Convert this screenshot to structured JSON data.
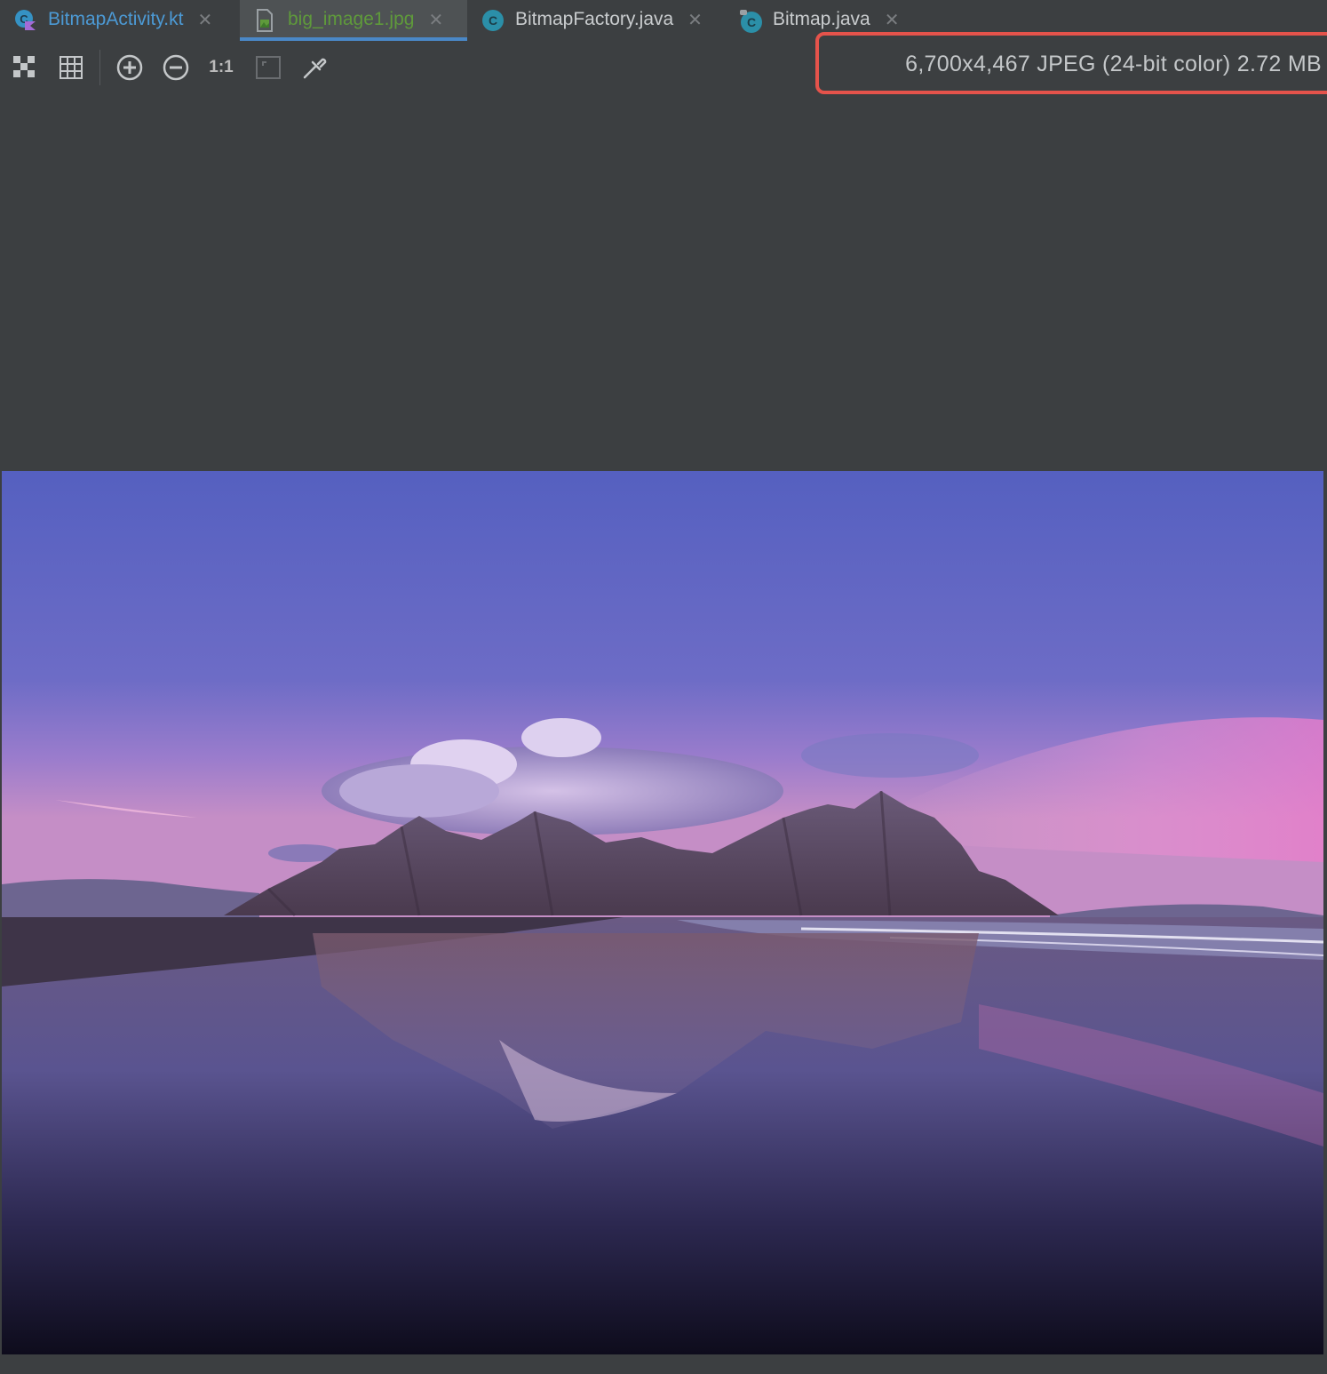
{
  "tabs": [
    {
      "label": "BitmapActivity.kt",
      "icon": "kotlin-class-icon",
      "active": false
    },
    {
      "label": "big_image1.jpg",
      "icon": "image-file-icon",
      "active": true
    },
    {
      "label": "BitmapFactory.java",
      "icon": "java-class-icon",
      "active": false
    },
    {
      "label": "Bitmap.java",
      "icon": "java-class-icon",
      "active": false
    }
  ],
  "toolbar": {
    "actual_size_label": "1:1",
    "buttons": [
      "chessboard-icon",
      "grid-icon",
      "zoom-in-icon",
      "zoom-out-icon",
      "actual-size-icon",
      "fit-zoom-icon",
      "color-picker-icon"
    ]
  },
  "image_info": "6,700x4,467 JPEG (24-bit color) 2.72 MB",
  "colors": {
    "background": "#3c3f41",
    "active_tab_underline": "#4a88c7",
    "highlight_box": "#e5534b"
  }
}
